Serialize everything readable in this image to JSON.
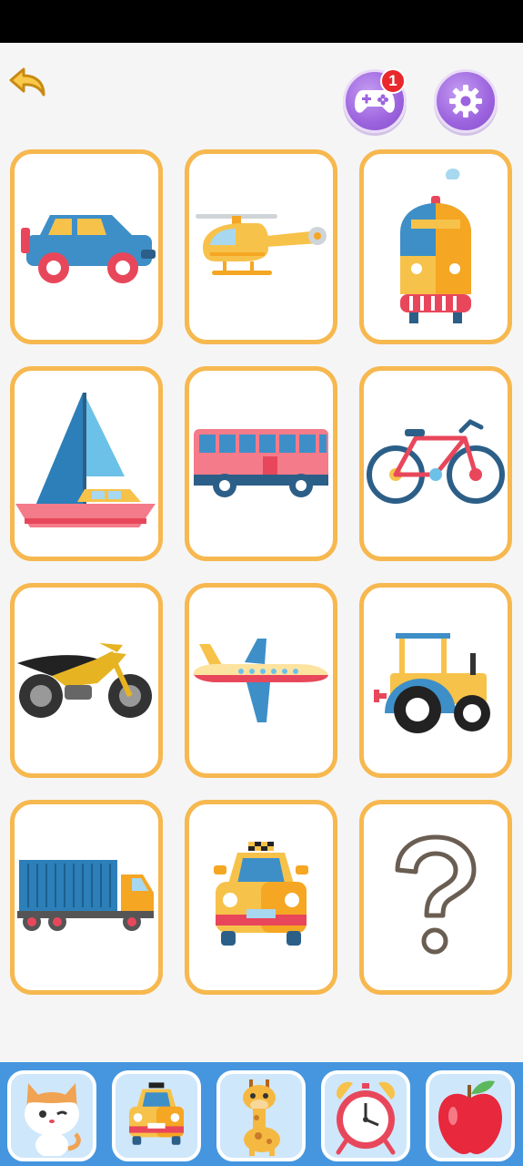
{
  "header": {
    "back_icon": "back-arrow-icon",
    "game_button": {
      "icon": "gamepad-icon",
      "badge_count": "1"
    },
    "settings_button": {
      "icon": "gear-icon"
    }
  },
  "cards": [
    {
      "name": "car",
      "icon": "car-icon"
    },
    {
      "name": "helicopter",
      "icon": "helicopter-icon"
    },
    {
      "name": "train",
      "icon": "train-icon"
    },
    {
      "name": "sailboat",
      "icon": "sailboat-icon"
    },
    {
      "name": "bus",
      "icon": "bus-icon"
    },
    {
      "name": "bicycle",
      "icon": "bicycle-icon"
    },
    {
      "name": "motorcycle",
      "icon": "motorcycle-icon"
    },
    {
      "name": "airplane",
      "icon": "airplane-icon"
    },
    {
      "name": "tractor",
      "icon": "tractor-icon"
    },
    {
      "name": "truck",
      "icon": "truck-icon"
    },
    {
      "name": "taxi",
      "icon": "taxi-icon"
    },
    {
      "name": "mystery",
      "icon": "question-mark-icon"
    }
  ],
  "bottom_categories": [
    {
      "name": "animals",
      "icon": "cat-icon"
    },
    {
      "name": "vehicles",
      "icon": "taxi-icon"
    },
    {
      "name": "zoo",
      "icon": "giraffe-icon"
    },
    {
      "name": "objects",
      "icon": "alarm-clock-icon"
    },
    {
      "name": "fruits",
      "icon": "apple-icon"
    }
  ],
  "colors": {
    "card_border": "#f6b84f",
    "button_purple": "#9c63de",
    "bottom_bar": "#4596de",
    "badge": "#e8282d"
  }
}
